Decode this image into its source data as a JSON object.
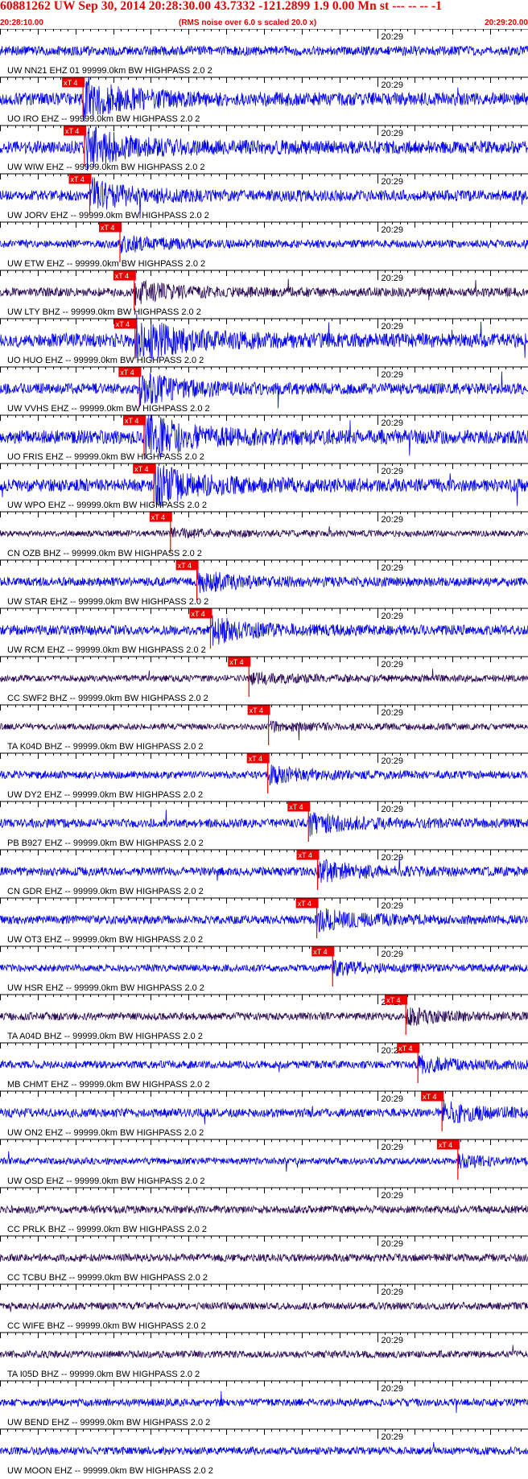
{
  "header": {
    "title": "60881262 UW Sep 30, 2014 20:28:30.00   43.7332 -121.2899  1.9 0.00 Mn st --- -- --  -1",
    "start_time": "20:28:10.00",
    "note": "(RMS noise over 6.0 s scaled 20.0 x)",
    "end_time": "20:29:20.00"
  },
  "colors": {
    "header_text": "#e00000",
    "trace_blue": "#0000ee",
    "trace_dark": "#2a0a55",
    "pick_bg": "#ee0000",
    "pick_line": "#ee0000",
    "axis": "#000000"
  },
  "chart_data": {
    "type": "line",
    "title": "60881262 UW Sep 30, 2014 20:28:30.00",
    "x_range_seconds": [
      0,
      70
    ],
    "x_start_label": "20:28:10.00",
    "x_end_label": "20:29:20.00",
    "minute_tick_label": "20:29",
    "minute_tick_seconds": 50,
    "pick_label": "xT 4",
    "series": [
      {
        "label": "UW NN21 EHZ 01 99999.0km BW  HIGHPASS  2.0  2",
        "pick_seconds": null,
        "color": "blue",
        "amplitude": 0.5
      },
      {
        "label": "UO IRO EHZ -- 99999.0km BW  HIGHPASS  2.0  2",
        "pick_seconds": 11.0,
        "color": "blue",
        "amplitude": 0.8
      },
      {
        "label": "UW WIW EHZ -- 99999.0km BW  HIGHPASS  2.0  2",
        "pick_seconds": 11.2,
        "color": "blue",
        "amplitude": 0.8
      },
      {
        "label": "UW JORV EHZ -- 99999.0km BW  HIGHPASS  2.0  2",
        "pick_seconds": 11.9,
        "color": "blue",
        "amplitude": 0.6
      },
      {
        "label": "UW ETW EHZ -- 99999.0km BW  HIGHPASS  2.0  2",
        "pick_seconds": 15.9,
        "color": "blue",
        "amplitude": 0.3
      },
      {
        "label": "UW LTY BHZ -- 99999.0km BW  HIGHPASS  2.0  2",
        "pick_seconds": 17.8,
        "color": "dark",
        "amplitude": 0.4
      },
      {
        "label": "UO HUO EHZ -- 99999.0km BW  HIGHPASS  2.0  2",
        "pick_seconds": 17.9,
        "color": "blue",
        "amplitude": 0.9
      },
      {
        "label": "UW VVHS EHZ -- 99999.0km BW  HIGHPASS  2.0  2",
        "pick_seconds": 18.5,
        "color": "blue",
        "amplitude": 0.6
      },
      {
        "label": "UO FRIS EHZ -- 99999.0km BW  HIGHPASS  2.0  2",
        "pick_seconds": 19.1,
        "color": "blue",
        "amplitude": 0.9
      },
      {
        "label": "UW WPO EHZ -- 99999.0km BW  HIGHPASS  2.0  2",
        "pick_seconds": 20.4,
        "color": "blue",
        "amplitude": 0.8
      },
      {
        "label": "CN OZB BHZ -- 99999.0km BW  HIGHPASS  2.0  2",
        "pick_seconds": 22.6,
        "color": "dark",
        "amplitude": 0.15
      },
      {
        "label": "UW STAR EHZ -- 99999.0km BW  HIGHPASS  2.0  2",
        "pick_seconds": 26.1,
        "color": "blue",
        "amplitude": 0.4
      },
      {
        "label": "UW RCM EHZ -- 99999.0km BW  HIGHPASS  2.0  2",
        "pick_seconds": 27.9,
        "color": "blue",
        "amplitude": 0.5
      },
      {
        "label": "CC SWF2 BHZ -- 99999.0km BW  HIGHPASS  2.0  2",
        "pick_seconds": 33.0,
        "color": "dark",
        "amplitude": 0.2
      },
      {
        "label": "TA K04D BHZ -- 99999.0km BW  HIGHPASS  2.0  2",
        "pick_seconds": 35.6,
        "color": "dark",
        "amplitude": 0.15
      },
      {
        "label": "UW DY2 EHZ -- 99999.0km BW  HIGHPASS  2.0  2",
        "pick_seconds": 35.5,
        "color": "blue",
        "amplitude": 0.3
      },
      {
        "label": "PB B927 EHZ -- 99999.0km BW  HIGHPASS  2.0  2",
        "pick_seconds": 40.9,
        "color": "blue",
        "amplitude": 0.4
      },
      {
        "label": "CN GDR EHZ -- 99999.0km BW  HIGHPASS  2.0  2",
        "pick_seconds": 42.1,
        "color": "blue",
        "amplitude": 0.4
      },
      {
        "label": "UW OT3 EHZ -- 99999.0km BW  HIGHPASS  2.0  2",
        "pick_seconds": 42.0,
        "color": "blue",
        "amplitude": 0.4
      },
      {
        "label": "UW HSR EHZ -- 99999.0km BW  HIGHPASS  2.0  2",
        "pick_seconds": 44.1,
        "color": "blue",
        "amplitude": 0.25
      },
      {
        "label": "TA A04D BHZ -- 99999.0km BW  HIGHPASS  2.0  2",
        "pick_seconds": 53.8,
        "color": "dark",
        "amplitude": 0.3
      },
      {
        "label": "MB CHMT EHZ -- 99999.0km BW  HIGHPASS  2.0  2",
        "pick_seconds": 55.4,
        "color": "blue",
        "amplitude": 0.3
      },
      {
        "label": "UW ON2 EHZ -- 99999.0km BW  HIGHPASS  2.0  2",
        "pick_seconds": 58.6,
        "color": "blue",
        "amplitude": 0.4
      },
      {
        "label": "UW OSD EHZ -- 99999.0km BW  HIGHPASS  2.0  2",
        "pick_seconds": 60.7,
        "color": "blue",
        "amplitude": 0.2
      },
      {
        "label": "CC PRLK BHZ -- 99999.0km BW  HIGHPASS  2.0  2",
        "pick_seconds": null,
        "color": "dark",
        "amplitude": 0.3
      },
      {
        "label": "CC TCBU BHZ -- 99999.0km BW  HIGHPASS  2.0  2",
        "pick_seconds": null,
        "color": "dark",
        "amplitude": 0.3
      },
      {
        "label": "CC WIFE BHZ -- 99999.0km BW  HIGHPASS  2.0  2",
        "pick_seconds": null,
        "color": "dark",
        "amplitude": 0.25
      },
      {
        "label": "TA I05D BHZ -- 99999.0km BW  HIGHPASS  2.0  2",
        "pick_seconds": null,
        "color": "dark",
        "amplitude": 0.25
      },
      {
        "label": "UW BEND EHZ -- 99999.0km BW  HIGHPASS  2.0  2",
        "pick_seconds": null,
        "color": "blue",
        "amplitude": 0.3
      },
      {
        "label": "UW MOON EHZ -- 99999.0km BW  HIGHPASS  2.0  2",
        "pick_seconds": null,
        "color": "blue",
        "amplitude": 0.3
      }
    ]
  }
}
